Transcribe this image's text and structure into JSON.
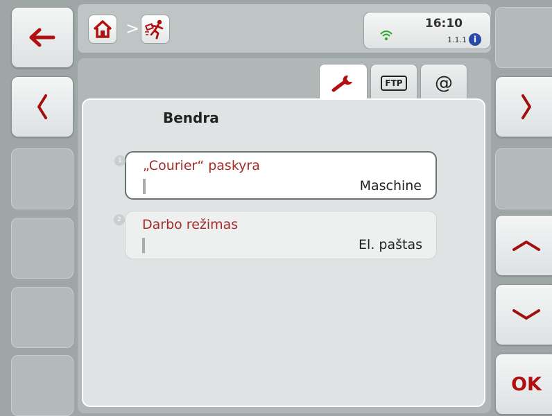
{
  "header": {
    "time": "16:10",
    "version": "1.1.1"
  },
  "tabs": [
    {
      "name": "settings",
      "label": ""
    },
    {
      "name": "ftp",
      "label": "FTP"
    },
    {
      "name": "email",
      "label": "@"
    }
  ],
  "panel": {
    "title": "Bendra",
    "items": [
      {
        "number": "1",
        "label": "„Courier“ paskyra",
        "value": "Maschine"
      },
      {
        "number": "2",
        "label": "Darbo režimas",
        "value": "El. paštas"
      }
    ]
  },
  "softkeys": {
    "ok_label": "OK"
  }
}
